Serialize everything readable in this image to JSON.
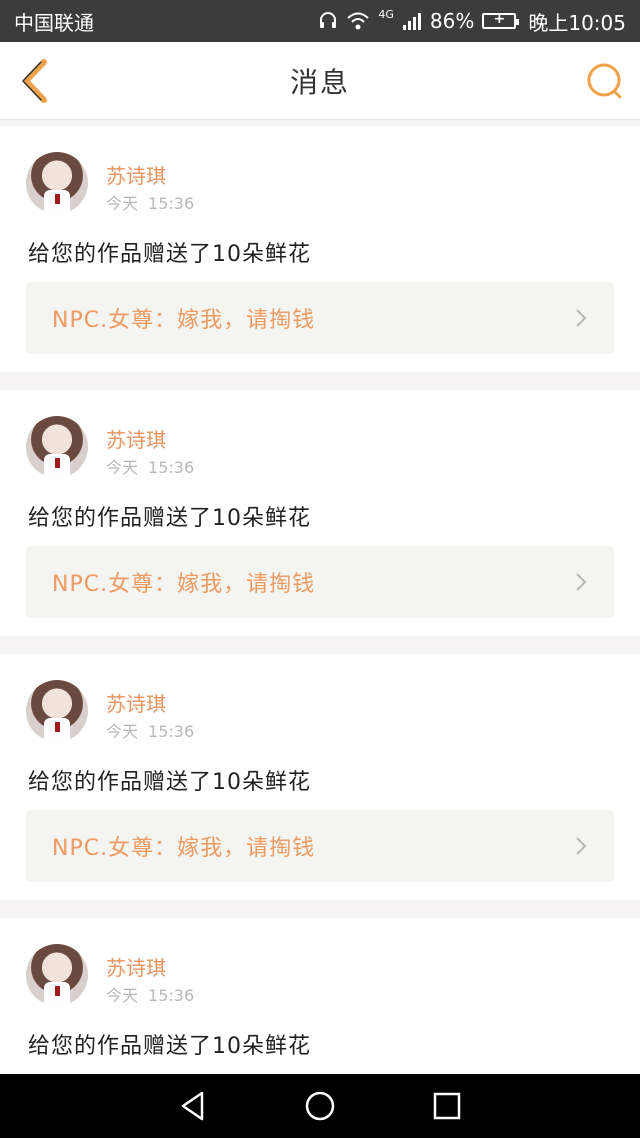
{
  "status_bar": {
    "carrier": "中国联通",
    "network": "4G",
    "battery": "86%",
    "time": "晚上10:05"
  },
  "header": {
    "title": "消息",
    "back_icon": "chevron-left-icon",
    "search_icon": "search-icon"
  },
  "colors": {
    "accent": "#ee9a63",
    "header_icon": "#f0a24a",
    "card_link_bg": "#f4f4f0"
  },
  "messages": [
    {
      "username": "苏诗琪",
      "day": "今天",
      "time": "15:36",
      "text": "给您的作品赠送了10朵鲜花",
      "work_title": "NPC.女尊：嫁我，请掏钱"
    },
    {
      "username": "苏诗琪",
      "day": "今天",
      "time": "15:36",
      "text": "给您的作品赠送了10朵鲜花",
      "work_title": "NPC.女尊：嫁我，请掏钱"
    },
    {
      "username": "苏诗琪",
      "day": "今天",
      "time": "15:36",
      "text": "给您的作品赠送了10朵鲜花",
      "work_title": "NPC.女尊：嫁我，请掏钱"
    },
    {
      "username": "苏诗琪",
      "day": "今天",
      "time": "15:36",
      "text": "给您的作品赠送了10朵鲜花",
      "work_title": ""
    }
  ],
  "nav_bar": {
    "back_icon": "triangle-back-icon",
    "home_icon": "circle-home-icon",
    "recents_icon": "square-recents-icon"
  }
}
